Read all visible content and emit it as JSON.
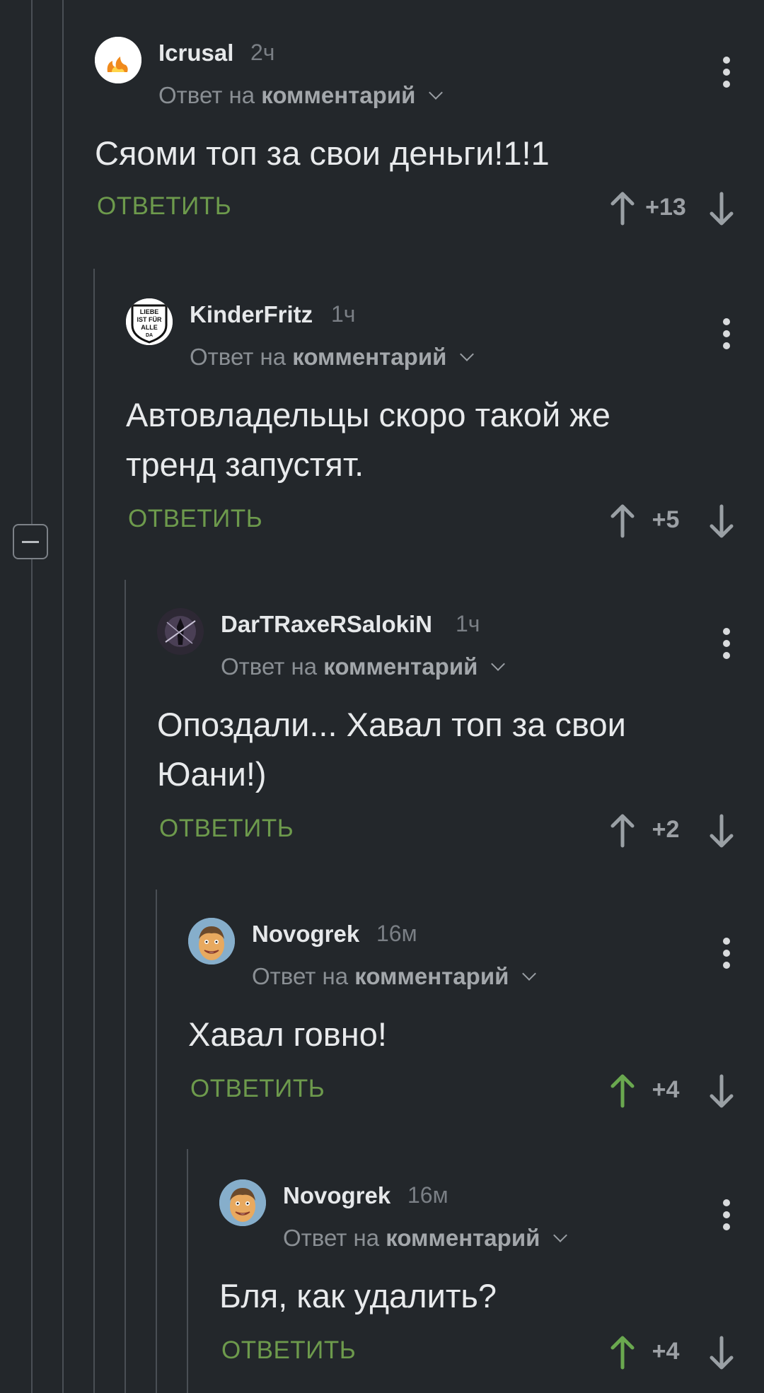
{
  "colors": {
    "background": "#23272b",
    "reply_link": "#6d9a4c",
    "upvoted_arrow": "#6aa84f",
    "neutral_arrow": "#9aa0a5"
  },
  "reply_to_label": "Ответ на",
  "reply_to_target": "комментарий",
  "reply_button_label": "ОТВЕТИТЬ",
  "comments": [
    {
      "author": "Icrusal",
      "time": "2ч",
      "text": "Сяоми топ за свои деньги!1!1",
      "score": "+13",
      "upvoted": false,
      "avatar": "fire-avatar"
    },
    {
      "author": "KinderFritz",
      "time": "1ч",
      "text": "Автовладельцы скоро такой же тренд запустят.",
      "score": "+5",
      "upvoted": false,
      "avatar": "liebe-badge-avatar",
      "avatar_text": [
        "LIEBE",
        "IST FÜR",
        "ALLE",
        "DA"
      ]
    },
    {
      "author": "DarTRaxeRSalokiN",
      "time": "1ч",
      "text": "Опоздали... Хавал топ за свои Юани!)",
      "score": "+2",
      "upvoted": false,
      "avatar": "dark-figure-avatar"
    },
    {
      "author": "Novogrek",
      "time": "16м",
      "text": "Хавал говно!",
      "score": "+4",
      "upvoted": true,
      "avatar": "face-avatar"
    },
    {
      "author": "Novogrek",
      "time": "16м",
      "text": "Бля, как удалить?",
      "score": "+4",
      "upvoted": true,
      "avatar": "face-avatar"
    }
  ]
}
